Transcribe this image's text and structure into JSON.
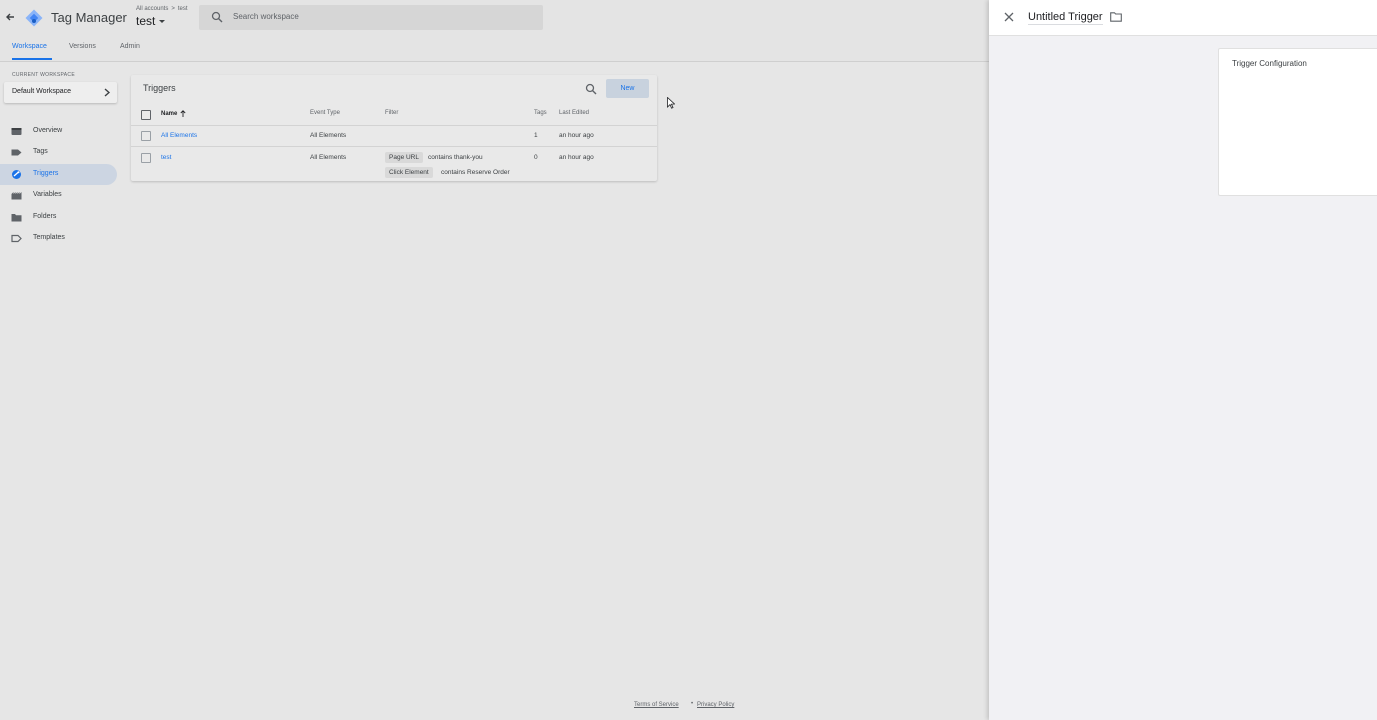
{
  "header": {
    "app_title": "Tag Manager",
    "breadcrumb": {
      "accounts": "All accounts",
      "separator": ">",
      "account": "test"
    },
    "container_name": "test",
    "search_placeholder": "Search workspace"
  },
  "tabs": [
    {
      "label": "Workspace",
      "active": true
    },
    {
      "label": "Versions",
      "active": false
    },
    {
      "label": "Admin",
      "active": false
    }
  ],
  "sidebar": {
    "current_workspace_label": "CURRENT WORKSPACE",
    "workspace_name": "Default Workspace",
    "items": [
      {
        "label": "Overview",
        "icon": "overview-icon",
        "active": false
      },
      {
        "label": "Tags",
        "icon": "tag-icon",
        "active": false
      },
      {
        "label": "Triggers",
        "icon": "trigger-icon",
        "active": true
      },
      {
        "label": "Variables",
        "icon": "variables-icon",
        "active": false
      },
      {
        "label": "Folders",
        "icon": "folder-icon",
        "active": false
      },
      {
        "label": "Templates",
        "icon": "template-icon",
        "active": false
      }
    ]
  },
  "triggers": {
    "title": "Triggers",
    "new_label": "New",
    "columns": {
      "name": "Name",
      "event_type": "Event Type",
      "filter": "Filter",
      "tags": "Tags",
      "last_edited": "Last Edited"
    },
    "rows": [
      {
        "name": "All Elements",
        "event_type": "All Elements",
        "filters": [],
        "tags": "1",
        "last_edited": "an hour ago"
      },
      {
        "name": "test",
        "event_type": "All Elements",
        "filters": [
          {
            "variable": "Page URL",
            "condition": "contains thank-you"
          },
          {
            "variable": "Click Element",
            "condition": "contains Reserve Order"
          }
        ],
        "tags": "0",
        "last_edited": "an hour ago"
      }
    ]
  },
  "footer": {
    "terms": "Terms of Service",
    "separator": "•",
    "privacy": "Privacy Policy"
  },
  "panel": {
    "title": "Untitled Trigger",
    "config_title": "Trigger Configuration"
  },
  "colors": {
    "accent": "#1a73e8",
    "overlay": "#e6e6e6",
    "panel_bg": "#f1f1f4"
  }
}
